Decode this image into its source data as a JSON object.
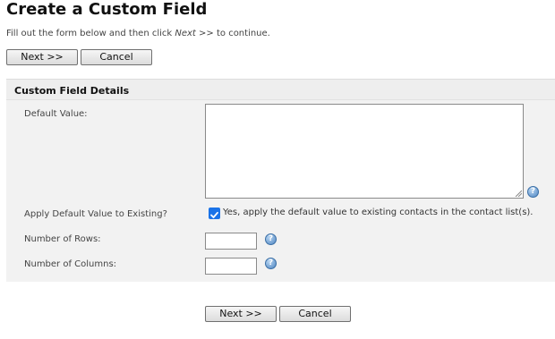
{
  "page": {
    "title": "Create a Custom Field",
    "intro_prefix": "Fill out the form below and then click ",
    "intro_emph": "Next >>",
    "intro_suffix": " to continue."
  },
  "buttons": {
    "next": "Next >>",
    "cancel": "Cancel"
  },
  "panel": {
    "title": "Custom Field Details"
  },
  "fields": {
    "default_value": {
      "label": "Default Value:",
      "value": ""
    },
    "apply_existing": {
      "label": "Apply Default Value to Existing?",
      "checked": true,
      "checkbox_label": "Yes, apply the default value to existing contacts in the contact list(s)."
    },
    "rows": {
      "label": "Number of Rows:",
      "value": ""
    },
    "columns": {
      "label": "Number of Columns:",
      "value": ""
    }
  },
  "icons": {
    "help": "help-icon",
    "check": "checkmark-icon"
  },
  "colors": {
    "accent": "#1a73e8",
    "panel_bg": "#f2f2f2",
    "help_blue": "#4f86c2"
  }
}
